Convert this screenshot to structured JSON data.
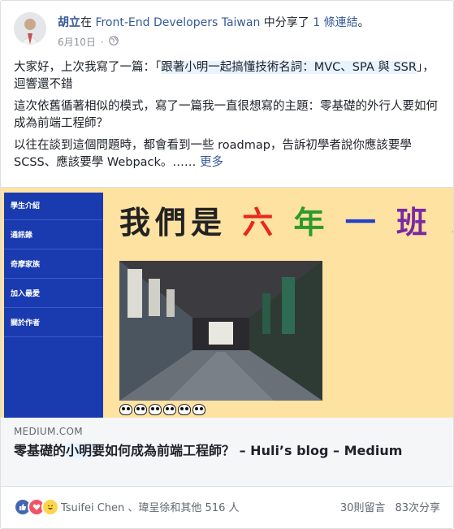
{
  "post": {
    "author": "胡立",
    "verb_in": "在",
    "group": "Front-End Developers Taiwan",
    "verb_shared": "中分享了",
    "count_link": "1 條連結",
    "trailing": "。",
    "date": "6月10日",
    "dot": "·",
    "paragraphs": {
      "p1_a": "大家好，上次我寫了一篇：「",
      "p1_link": "跟著小明一起搞懂技術名詞：MVC、SPA 與 SSR",
      "p1_b": "」，迴響還不錯",
      "p2": "這次依舊循著相似的模式，寫了一篇我一直很想寫的主題：零基礎的外行人要如何成為前端工程師？",
      "p3": "以往在談到這個問題時，都會看到一些 roadmap，告訴初學者說你應該要學 SCSS、應該要學 Webpack。……",
      "more": "更多"
    }
  },
  "preview": {
    "sidebar": [
      "學生介紹",
      "通訊錄",
      "奇摩家族",
      "加入最愛",
      "關於作者"
    ],
    "banner": {
      "a": "我們是",
      "b": "六",
      "c": "年",
      "d": "一",
      "e": "班",
      "f": "！！"
    },
    "colors": {
      "six": "#e8281c",
      "year": "#2e9a2e",
      "one": "#2040c8",
      "class": "#7a2aa0"
    }
  },
  "link": {
    "domain": "MEDIUM.COM",
    "title_a": "零基礎的",
    "title_hl": "小明",
    "title_b": "要如何成為前端工程師？ – Huli’s blog – Medium"
  },
  "footer": {
    "reactions": [
      "like-icon",
      "love-icon",
      "haha-icon"
    ],
    "reacted_by": "Tsuifei Chen 、瑋呈徐和其他 516 人",
    "comments": "30則留言",
    "shares": "83次分享"
  }
}
